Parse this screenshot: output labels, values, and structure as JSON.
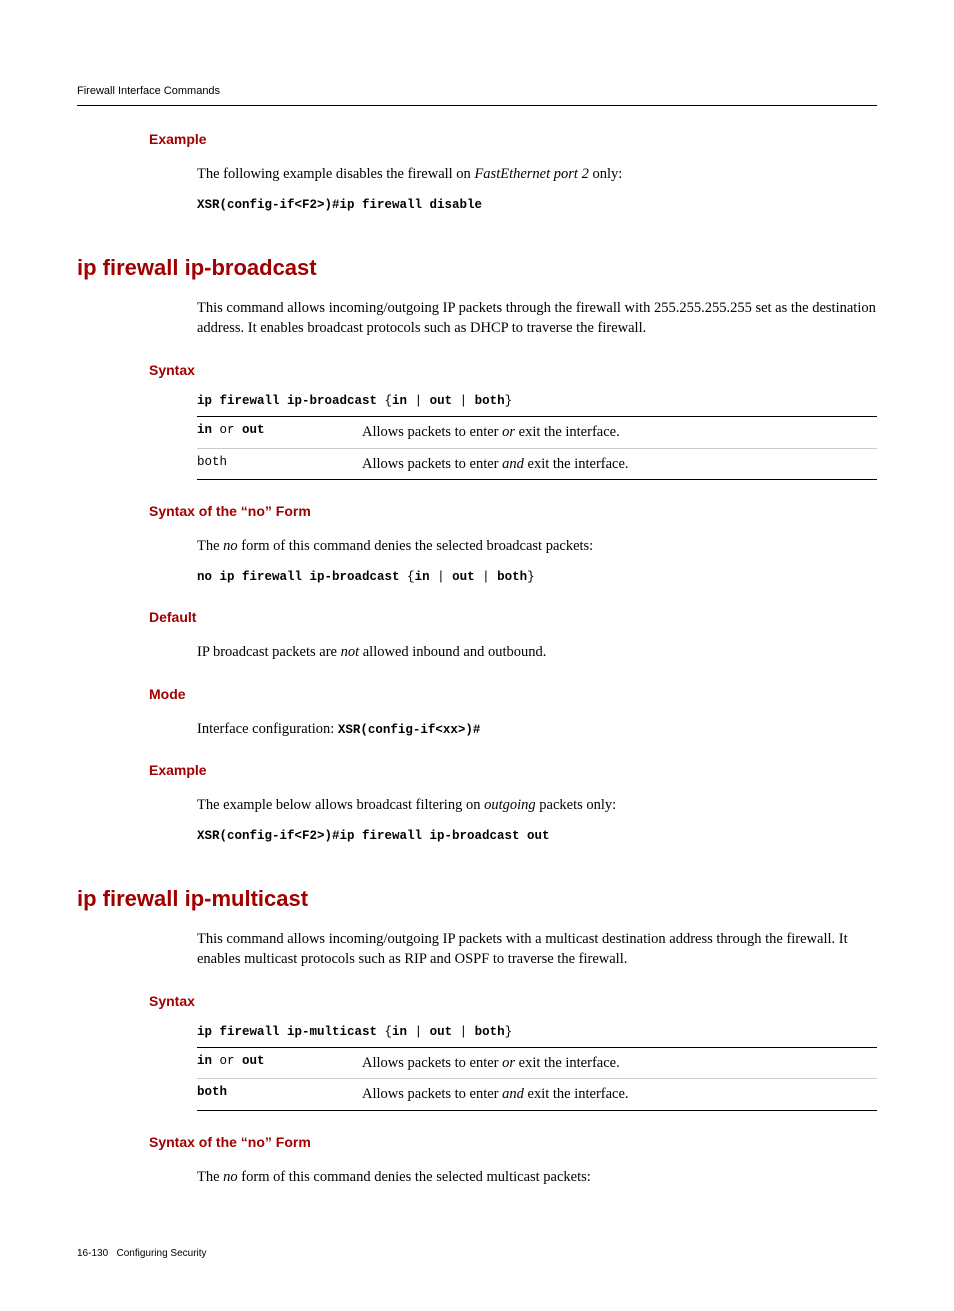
{
  "header": "Firewall Interface Commands",
  "sec1": {
    "heading": "Example",
    "text_a": "The following example disables the firewall on ",
    "text_b": "FastEthernet port 2",
    "text_c": " only:",
    "code": "XSR(config-if<F2>)#ip firewall disable"
  },
  "cmd_broadcast": {
    "title": "ip firewall ip-broadcast",
    "intro": "This command allows incoming/outgoing IP packets through the firewall with 255.255.255.255 set as the destination address. It enables broadcast protocols such as DHCP to traverse the firewall.",
    "syntax": {
      "heading": "Syntax",
      "code_a": "ip firewall ip-broadcast",
      "code_b": " {",
      "code_c": "in",
      "code_d": " | ",
      "code_e": "out",
      "code_f": " | ",
      "code_g": "both",
      "code_h": "}",
      "rows": [
        {
          "k_a": "in",
          "k_b": " or ",
          "k_c": "out",
          "d_a": "Allows packets to enter ",
          "d_b": "or",
          "d_c": " exit the interface."
        },
        {
          "k_both": "both",
          "d_a": "Allows packets to enter ",
          "d_b": "and",
          "d_c": " exit the interface."
        }
      ]
    },
    "noform": {
      "heading": "Syntax of the “no” Form",
      "t_a": "The ",
      "t_b": "no",
      "t_c": " form of this command denies the selected broadcast packets:",
      "code_a": "no ip firewall ip-broadcast",
      "code_b": " {",
      "code_c": "in",
      "code_d": " | ",
      "code_e": "out",
      "code_f": " | ",
      "code_g": "both",
      "code_h": "}"
    },
    "default": {
      "heading": "Default",
      "t_a": "IP broadcast packets are ",
      "t_b": "not",
      "t_c": " allowed inbound and outbound."
    },
    "mode": {
      "heading": "Mode",
      "t_a": "Interface configuration: ",
      "t_b": "XSR(config-if<xx>)#"
    },
    "example": {
      "heading": "Example",
      "t_a": "The example below allows broadcast filtering on ",
      "t_b": "outgoing",
      "t_c": " packets only:",
      "code": "XSR(config-if<F2>)#ip firewall ip-broadcast out"
    }
  },
  "cmd_multicast": {
    "title": "ip firewall ip-multicast",
    "intro": "This command allows incoming/outgoing IP packets with a multicast destination address through the firewall. It enables multicast protocols such as RIP and OSPF to traverse the firewall.",
    "syntax": {
      "heading": "Syntax",
      "code_a": "ip firewall ip-multicast",
      "code_b": " {",
      "code_c": "in",
      "code_d": " | ",
      "code_e": "out",
      "code_f": " | ",
      "code_g": "both",
      "code_h": "}",
      "rows": [
        {
          "k_a": "in",
          "k_b": " or ",
          "k_c": "out",
          "d_a": "Allows packets to enter ",
          "d_b": "or",
          "d_c": " exit the interface."
        },
        {
          "k_both": "both",
          "d_a": "Allows packets to enter ",
          "d_b": "and",
          "d_c": " exit the interface."
        }
      ]
    },
    "noform": {
      "heading": "Syntax of the “no” Form",
      "t_a": "The ",
      "t_b": "no",
      "t_c": " form of this command denies the selected multicast packets:"
    }
  },
  "footer": {
    "page": "16-130",
    "label": "Configuring Security"
  }
}
